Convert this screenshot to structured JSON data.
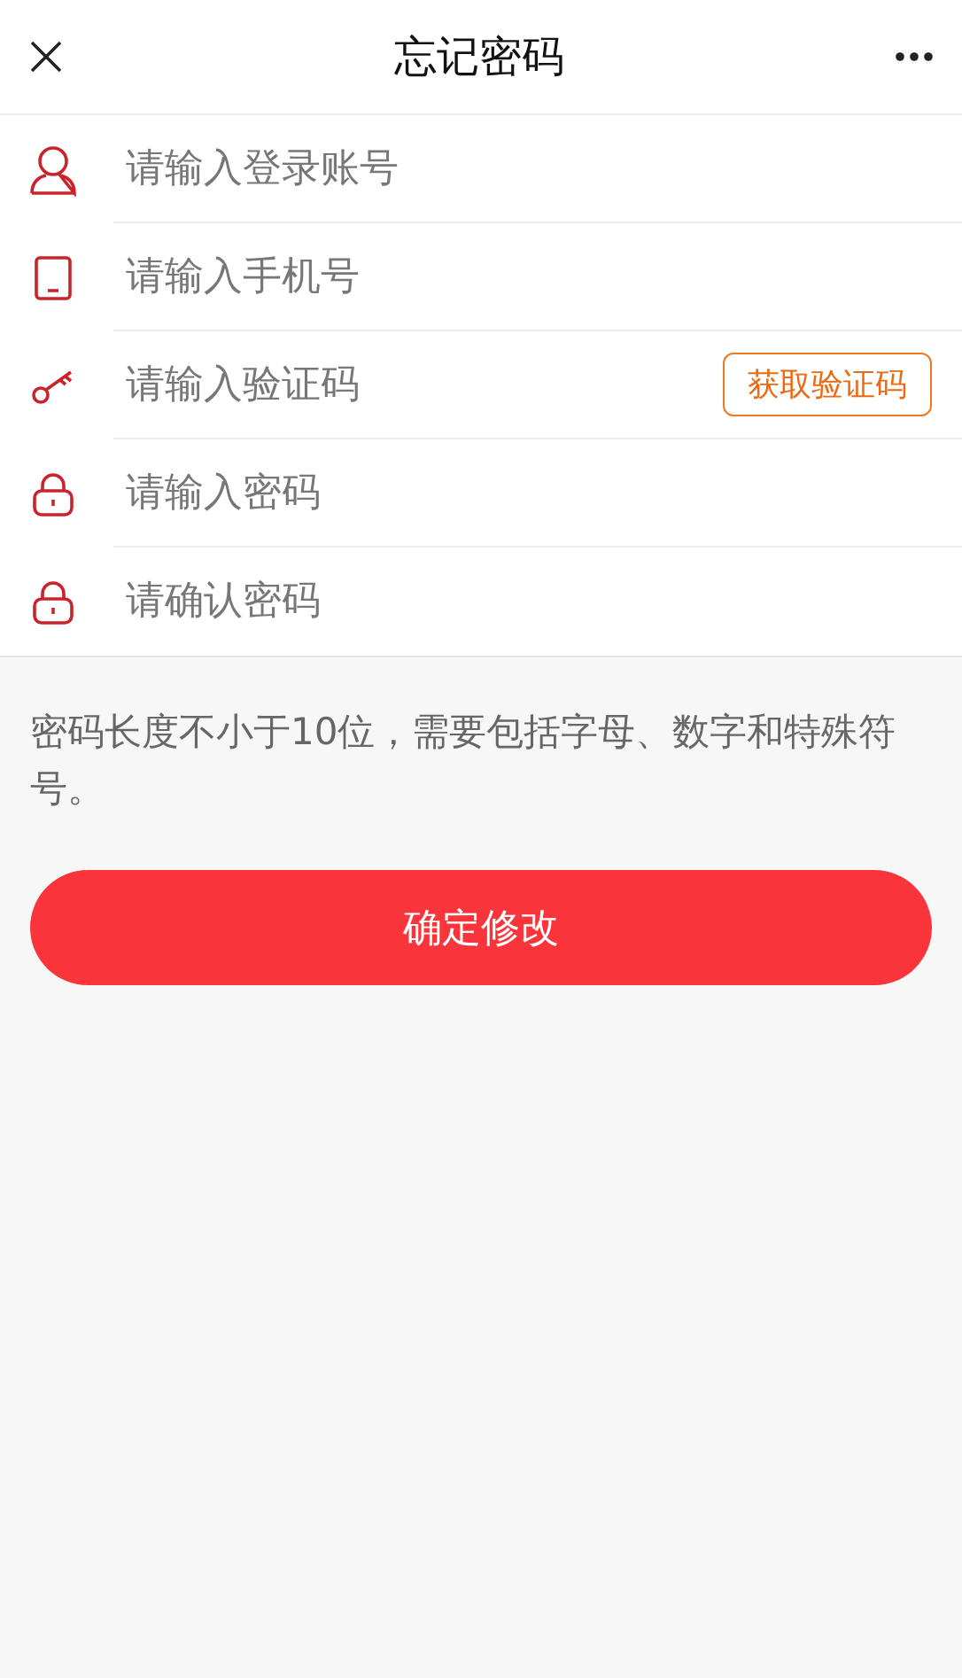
{
  "header": {
    "title": "忘记密码"
  },
  "fields": [
    {
      "kind": "user",
      "placeholder": "请输入登录账号"
    },
    {
      "kind": "phone",
      "placeholder": "请输入手机号"
    },
    {
      "kind": "key",
      "placeholder": "请输入验证码",
      "action": "获取验证码"
    },
    {
      "kind": "lock",
      "placeholder": "请输入密码"
    },
    {
      "kind": "lock",
      "placeholder": "请确认密码"
    }
  ],
  "hint": "密码长度不小于10位，需要包括字母、数字和特殊符号。",
  "submit": "确定修改"
}
